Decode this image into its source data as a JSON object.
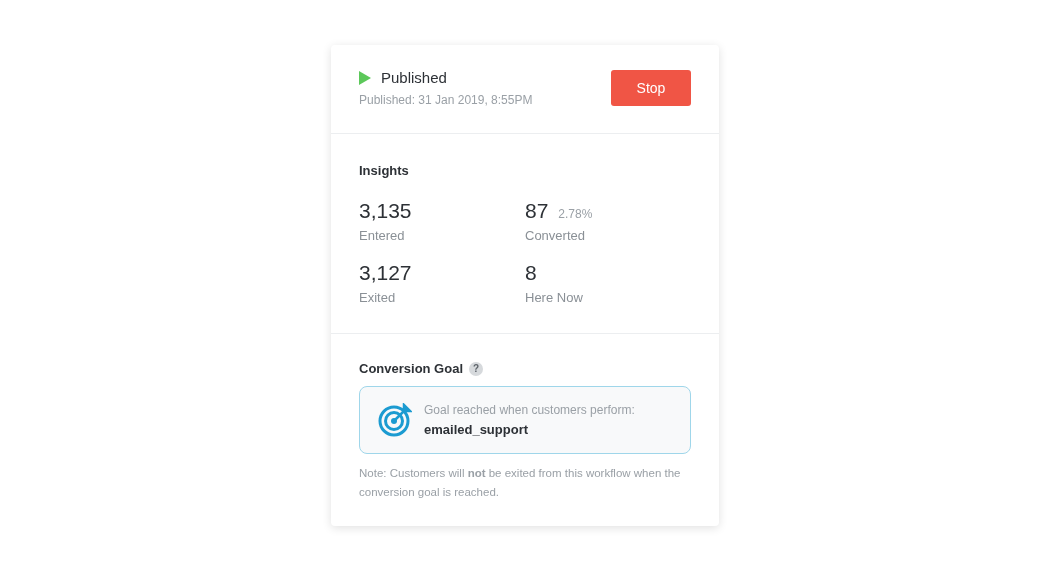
{
  "status": {
    "title": "Published",
    "subtitle": "Published: 31 Jan 2019, 8:55PM",
    "button": "Stop"
  },
  "insights": {
    "title": "Insights",
    "stats": [
      {
        "value": "3,135",
        "label": "Entered"
      },
      {
        "value": "87",
        "extra": "2.78%",
        "label": "Converted"
      },
      {
        "value": "3,127",
        "label": "Exited"
      },
      {
        "value": "8",
        "label": "Here Now"
      }
    ]
  },
  "goal": {
    "title": "Conversion Goal",
    "help": "?",
    "description": "Goal reached when customers perform:",
    "event": "emailed_support",
    "note": "Note: Customers will **not** be exited from this workflow when the conversion goal is reached."
  }
}
